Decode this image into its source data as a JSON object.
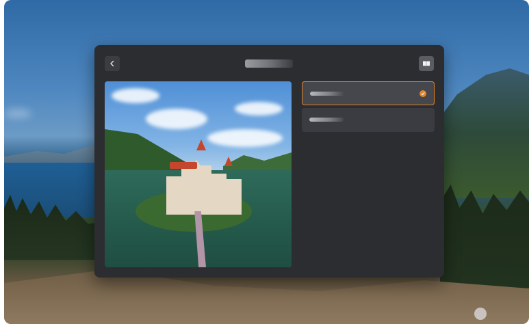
{
  "window": {
    "title": ""
  },
  "header": {
    "title": "",
    "back_icon": "chevron-left-icon",
    "book_icon": "open-book-icon"
  },
  "preview": {
    "alt": ""
  },
  "options": [
    {
      "label": "",
      "selected": true,
      "check_icon": "check-circle-icon"
    },
    {
      "label": "",
      "selected": false
    }
  ],
  "colors": {
    "dialog_bg": "#2b2d31",
    "accent": "#e6832b",
    "option_bg": "#3a3c41"
  }
}
